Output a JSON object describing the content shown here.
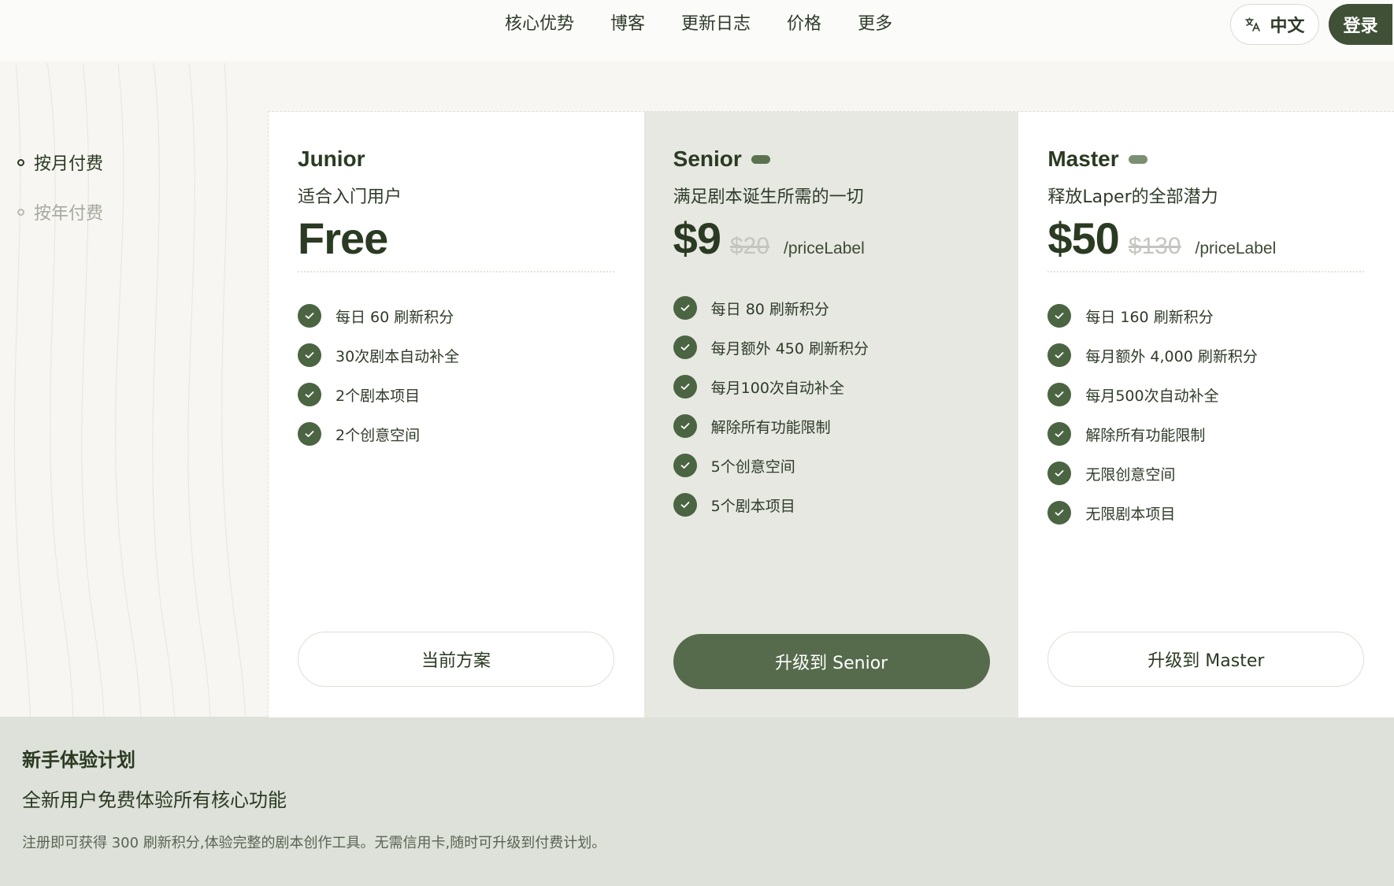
{
  "nav": {
    "items": [
      "核心优势",
      "博客",
      "更新日志",
      "价格",
      "更多"
    ],
    "language_label": "中文",
    "login_label": "登录"
  },
  "billing": {
    "options": [
      {
        "label": "按月付费",
        "active": true
      },
      {
        "label": "按年付费",
        "active": false
      }
    ]
  },
  "plans": [
    {
      "name": "Junior",
      "description": "适合入门用户",
      "price": "Free",
      "original_price": "",
      "price_label": "",
      "features": [
        "每日 60 刷新积分",
        "30次剧本自动补全",
        "2个剧本项目",
        "2个创意空间"
      ],
      "cta": "当前方案"
    },
    {
      "name": "Senior",
      "description": "满足剧本诞生所需的一切",
      "price": "$9",
      "original_price": "$20",
      "price_label": "/priceLabel",
      "features": [
        "每日 80 刷新积分",
        "每月额外 450 刷新积分",
        "每月100次自动补全",
        "解除所有功能限制",
        "5个创意空间",
        "5个剧本项目"
      ],
      "cta": "升级到 Senior"
    },
    {
      "name": "Master",
      "description": "释放Laper的全部潜力",
      "price": "$50",
      "original_price": "$130",
      "price_label": "/priceLabel",
      "features": [
        "每日 160 刷新积分",
        "每月额外 4,000 刷新积分",
        "每月500次自动补全",
        "解除所有功能限制",
        "无限创意空间",
        "无限剧本项目"
      ],
      "cta": "升级到 Master"
    }
  ],
  "banner": {
    "title": "新手体验计划",
    "subtitle": "全新用户免费体验所有核心功能",
    "note": "注册即可获得 300 刷新积分,体验完整的剧本创作工具。无需信用卡,随时可升级到付费计划。"
  },
  "colors": {
    "accent": "#566b4c",
    "check": "#4b6442",
    "text": "#2b3a22",
    "featured_bg": "#e6e8e1",
    "banner_bg": "#dde1d9"
  }
}
